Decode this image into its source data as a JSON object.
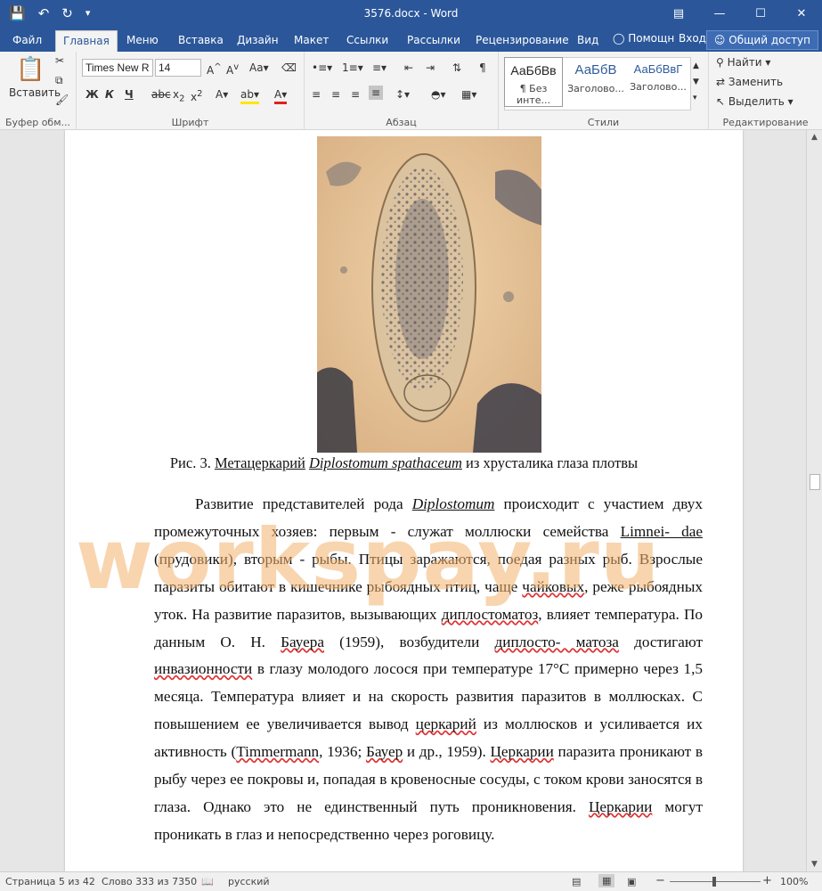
{
  "window": {
    "title": "3576.docx - Word"
  },
  "tabs": [
    "Файл",
    "Главная",
    "Меню",
    "Вставка",
    "Дизайн",
    "Макет",
    "Ссылки",
    "Рассылки",
    "Рецензирование",
    "Вид"
  ],
  "tellme": "Помощн",
  "login": "Вход",
  "share": "Общий доступ",
  "ribbon": {
    "paste": "Вставить",
    "font_name": "Times New R",
    "font_size": "14",
    "styles": [
      {
        "sample": "АаБбВв",
        "name": "¶ Без инте..."
      },
      {
        "sample": "АаБбВ",
        "name": "Заголово..."
      },
      {
        "sample": "АаБбВвГ",
        "name": "Заголово..."
      }
    ],
    "find": "Найти",
    "replace": "Заменить",
    "select": "Выделить",
    "groups": [
      "Буфер обм...",
      "Шрифт",
      "Абзац",
      "Стили",
      "Редактирование"
    ]
  },
  "document": {
    "caption_pre": "Рис. 3. ",
    "caption_word": "Метацеркарий",
    "caption_genus": "Diplostomum spathaceum",
    "caption_post": " из хрусталика глаза плотвы",
    "paragraph": {
      "p1": "Развитие представителей рода ",
      "genus": "Diplostomum",
      "p2": " происходит с участием двух промежуточных хозяев: первым - служат моллюски семейства ",
      "limnei": "Limnei- dae",
      "p3": " (прудовики), вторым - рыбы. Птицы заражаются, поедая разных рыб. Взрослые паразиты обитают в кишечнике рыбоядных птиц, чаще ",
      "chaik": "чайковых",
      "p4": ", реже рыбоядных уток. На развитие паразитов, вызывающих ",
      "dipl1": "диплостоматоз",
      "p5": ", влияет температура. По данным О. Н. ",
      "bauer1": "Бауера",
      "p6": " (1959), возбудители ",
      "dipl2": "диплосто- матоза",
      "p7": " достигают ",
      "invaz": "инвазионности",
      "p8": " в глазу молодого лосося при температуре 17°С примерно через 1,5 месяца. Температура влияет и на скорость развития паразитов в моллюсках. С повышением ее увеличивается вывод ",
      "cerk1": "церкарий",
      "p9": " из моллюсков и усиливается их активность (",
      "timm": "Timmermann",
      "p10": ", 1936; ",
      "bauer2": "Бауер",
      "p11": " и др., 1959). ",
      "cerk2": "Церкарии",
      "p12": " паразита проникают в рыбу через ее покровы и, попадая в кровеносные сосуды, с током крови заносятся в глаза. Однако это не единственный путь проникновения. ",
      "cerk3": "Церкарии",
      "p13": " могут проникать в глаз и непосредственно через роговицу."
    }
  },
  "watermark": "workspay.ru",
  "status": {
    "page": "Страница 5 из 42",
    "words": "Слово 333 из 7350",
    "language": "русский",
    "zoom": "100%"
  }
}
